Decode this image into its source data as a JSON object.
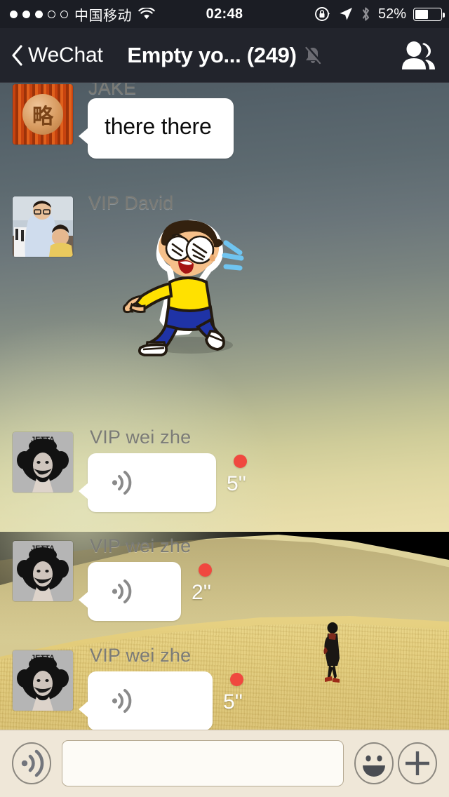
{
  "status_bar": {
    "signal_dots_filled": 3,
    "signal_dots_total": 5,
    "carrier": "中国移动",
    "wifi_icon": "wifi-icon",
    "time": "02:48",
    "rotation_lock_icon": "rotation-lock-icon",
    "location_icon": "location-arrow-icon",
    "bluetooth_icon": "bluetooth-icon",
    "battery_percent": "52%",
    "battery_level": 52
  },
  "nav_bar": {
    "back_icon": "chevron-left-icon",
    "back_label": "WeChat",
    "title": "Empty yo... (249)",
    "mute_icon": "bell-muted-icon",
    "contacts_icon": "group-contacts-icon"
  },
  "messages": [
    {
      "id": "msg-jake",
      "sender": "JAKE",
      "avatar_name": "avatar-jake",
      "type": "text",
      "text": "there there"
    },
    {
      "id": "msg-vip-david",
      "sender": "VIP David",
      "avatar_name": "avatar-vip-david",
      "type": "sticker",
      "sticker_name": "running-boy-sticker"
    },
    {
      "id": "msg-voice-1",
      "sender": "VIP wei zhe",
      "avatar_name": "avatar-vip-wei-zhe",
      "avatar_label": "JETTA",
      "type": "voice",
      "duration": "5''",
      "unread": true
    },
    {
      "id": "msg-voice-2",
      "sender": "VIP wei zhe",
      "avatar_name": "avatar-vip-wei-zhe",
      "avatar_label": "JETTA",
      "type": "voice",
      "duration": "2''",
      "unread": true
    },
    {
      "id": "msg-voice-3",
      "sender": "VIP wei zhe",
      "avatar_name": "avatar-vip-wei-zhe",
      "avatar_label": "JETTA",
      "type": "voice",
      "duration": "5''",
      "unread": true
    }
  ],
  "toolbar": {
    "voice_icon": "voice-record-icon",
    "input_value": "",
    "input_placeholder": "",
    "emoji_icon": "smiley-face-icon",
    "plus_icon": "plus-icon"
  },
  "colors": {
    "navbar_bg": "#22242c",
    "statusbar_bg": "#1b1d24",
    "bubble_bg": "#ffffff",
    "unread_dot": "#f0483f",
    "toolbar_bg": "#efe7d8",
    "sender_name": "#7b7b76"
  }
}
